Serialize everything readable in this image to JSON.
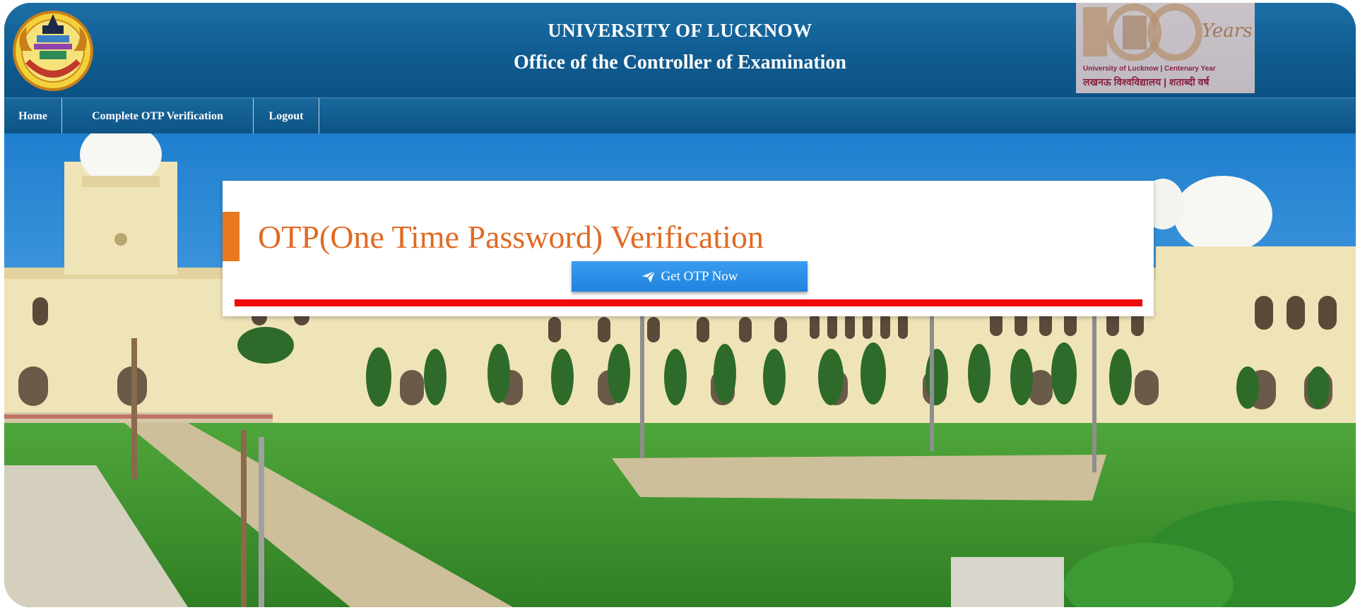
{
  "header": {
    "university_name": "UNIVERSITY OF LUCKNOW",
    "office_name": "Office of the Controller of Examination",
    "centenary_line1": "University of Lucknow | Centenary Year",
    "centenary_line2": "लखनऊ विश्वविद्यालय | शताब्दी वर्ष"
  },
  "nav": {
    "items": [
      {
        "label": "Home"
      },
      {
        "label": "Complete OTP Verification"
      },
      {
        "label": "Logout"
      }
    ]
  },
  "card": {
    "title": "OTP(One Time Password) Verification",
    "button_label": "Get OTP Now"
  },
  "colors": {
    "header_blue": "#105c91",
    "title_orange": "#e06a24",
    "accent_orange": "#e8781f",
    "button_blue": "#2a8fe8",
    "divider_red": "#ee0b0b"
  },
  "icons": {
    "logo": "university-emblem-icon",
    "button": "paper-plane-icon"
  }
}
